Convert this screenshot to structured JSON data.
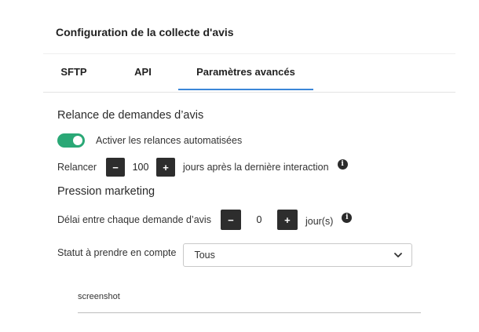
{
  "header": {
    "title": "Configuration de la collecte d'avis"
  },
  "tabs": [
    {
      "label": "SFTP",
      "active": false
    },
    {
      "label": "API",
      "active": false
    },
    {
      "label": "Paramètres avancés",
      "active": true
    }
  ],
  "relance": {
    "section_title": "Relance de demandes d’avis",
    "toggle_label": "Activer les relances automatisées",
    "toggle_on": true,
    "prefix_label": "Relancer",
    "minus_label": "−",
    "plus_label": "+",
    "value": "100",
    "suffix_label": "jours après la dernière interaction",
    "info_icon": "info-icon"
  },
  "pression": {
    "section_title": "Pression marketing",
    "delay_label": "Délai entre chaque demande d’avis",
    "minus_label": "−",
    "plus_label": "+",
    "value": "0",
    "suffix_label": "jour(s)",
    "info_icon": "info-icon",
    "status_label": "Statut à prendre en compte",
    "status_selected": "Tous"
  },
  "footer": {
    "input_value": "screenshot"
  },
  "colors": {
    "accent_tab": "#3a86d8",
    "toggle_on": "#2aa876",
    "stepper_button": "#2d2d2d"
  }
}
